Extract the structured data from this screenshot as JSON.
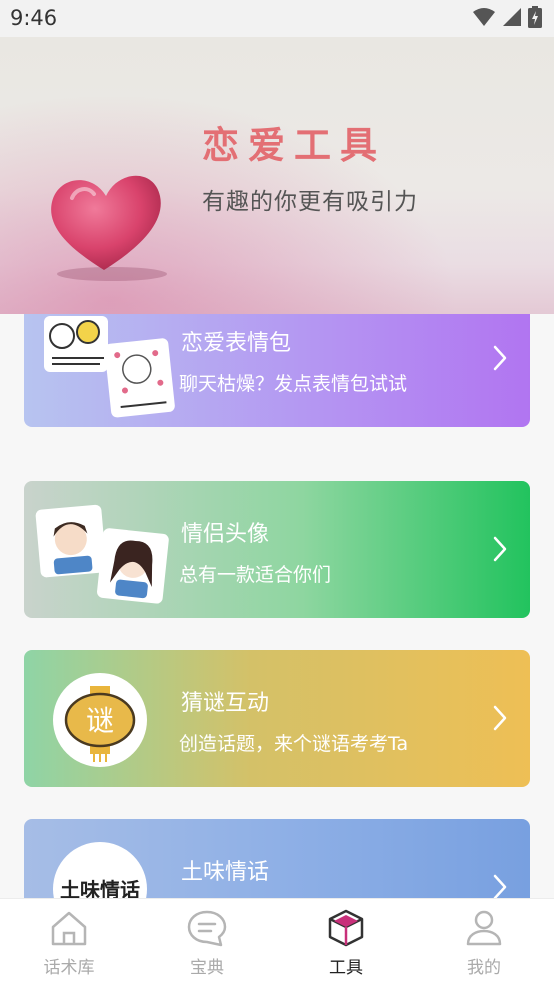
{
  "status_bar": {
    "time": "9:46"
  },
  "banner": {
    "title": "恋爱工具",
    "subtitle": "有趣的你更有吸引力"
  },
  "tools": [
    {
      "title": "恋爱表情包",
      "desc": "聊天枯燥？发点表情包试试"
    },
    {
      "title": "情侣头像",
      "desc": "总有一款适合你们"
    },
    {
      "title": "猜谜互动",
      "desc": "创造话题，来个谜语考考Ta",
      "icon_text": "谜"
    },
    {
      "title": "土味情话",
      "desc": "",
      "icon_text": "土味情话"
    }
  ],
  "tabs": [
    {
      "label": "话术库",
      "icon": "house-icon"
    },
    {
      "label": "宝典",
      "icon": "chat-bubble-icon"
    },
    {
      "label": "工具",
      "icon": "cube-icon",
      "active": true
    },
    {
      "label": "我的",
      "icon": "user-icon"
    }
  ],
  "colors": {
    "accent_title": "#e36f74",
    "tab_inactive": "#aaaaaa",
    "tab_active": "#222222",
    "cube_icon": "#c8307a"
  }
}
